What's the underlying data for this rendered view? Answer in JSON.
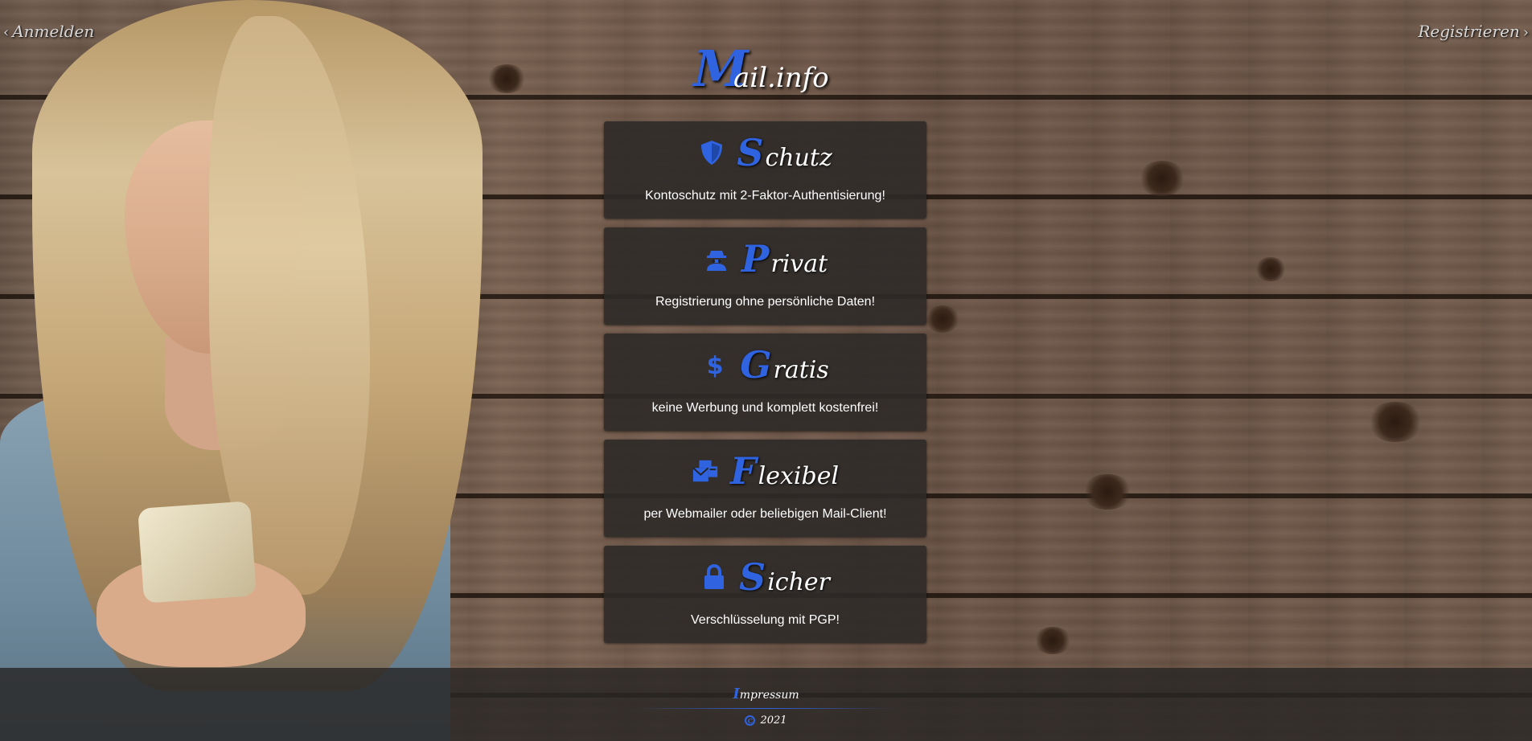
{
  "nav": {
    "login_label": "Anmelden",
    "register_label": "Registrieren"
  },
  "logo": {
    "initial": "M",
    "rest": "ail.info"
  },
  "cards": [
    {
      "icon": "shield-icon",
      "initial": "S",
      "rest": "chutz",
      "desc": "Kontoschutz mit 2-Faktor-Authentisierung!"
    },
    {
      "icon": "user-secret-icon",
      "initial": "P",
      "rest": "rivat",
      "desc": "Registrierung ohne persönliche Daten!"
    },
    {
      "icon": "dollar-icon",
      "initial": "G",
      "rest": "ratis",
      "desc": "keine Werbung und komplett kostenfrei!"
    },
    {
      "icon": "mail-bulk-icon",
      "initial": "F",
      "rest": "lexibel",
      "desc": "per Webmailer oder beliebigen Mail-Client!"
    },
    {
      "icon": "lock-icon",
      "initial": "S",
      "rest": "icher",
      "desc": "Verschlüsselung mit PGP!"
    }
  ],
  "footer": {
    "impressum_initial": "I",
    "impressum_rest": "mpressum",
    "year": "2021",
    "copyright_icon": "copyright-icon"
  },
  "colors": {
    "accent": "#2f63e0",
    "card_bg": "#2d2a28"
  }
}
